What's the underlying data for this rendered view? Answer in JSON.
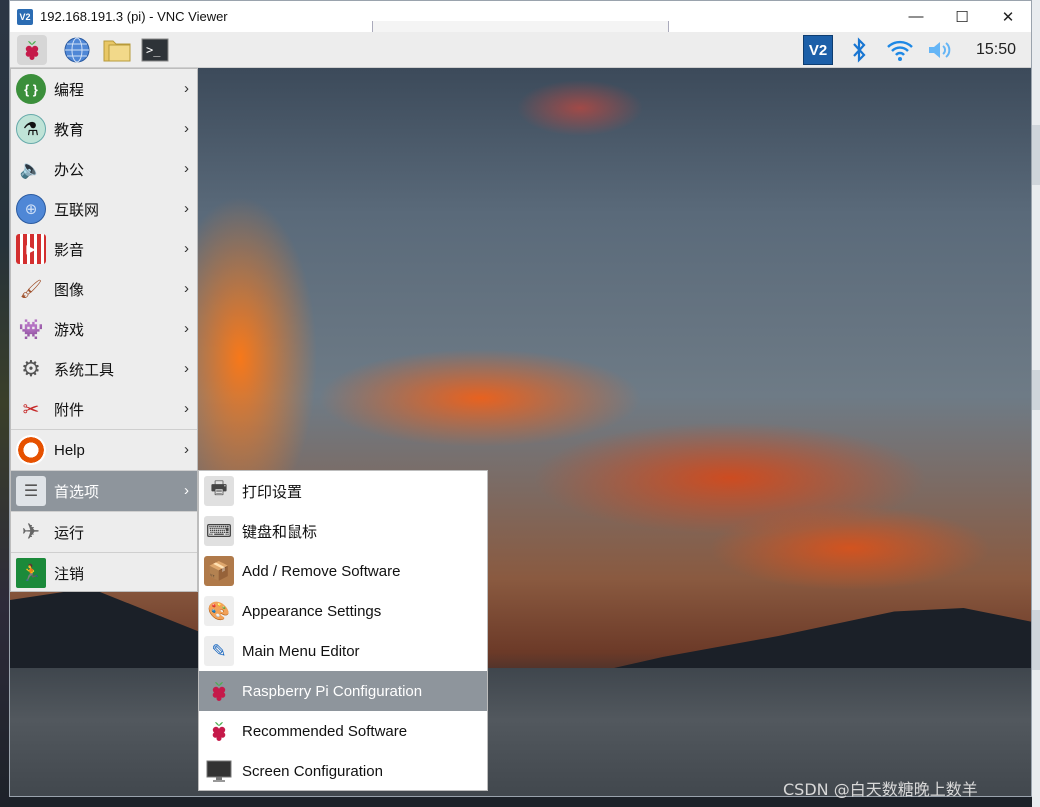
{
  "window": {
    "title": "192.168.191.3 (pi) - VNC Viewer",
    "app_icon": "V2",
    "minimize": "—",
    "maximize": "☐",
    "close": "✕"
  },
  "panel": {
    "clock": "15:50",
    "icons": [
      "raspberry-menu-icon",
      "web-browser-icon",
      "file-manager-icon",
      "terminal-icon",
      "vnc-icon",
      "bluetooth-icon",
      "wifi-icon",
      "volume-icon"
    ]
  },
  "menu": {
    "items": [
      {
        "label": "编程",
        "icon": "programming-icon"
      },
      {
        "label": "教育",
        "icon": "education-icon"
      },
      {
        "label": "办公",
        "icon": "office-icon"
      },
      {
        "label": "互联网",
        "icon": "internet-icon"
      },
      {
        "label": "影音",
        "icon": "sound-video-icon"
      },
      {
        "label": "图像",
        "icon": "graphics-icon"
      },
      {
        "label": "游戏",
        "icon": "games-icon"
      },
      {
        "label": "系统工具",
        "icon": "system-tools-icon"
      },
      {
        "label": "附件",
        "icon": "accessories-icon"
      },
      {
        "label": "Help",
        "icon": "help-icon"
      },
      {
        "label": "首选项",
        "icon": "preferences-icon"
      },
      {
        "label": "运行",
        "icon": "run-icon"
      },
      {
        "label": "注销",
        "icon": "logout-icon"
      }
    ]
  },
  "submenu": {
    "items": [
      {
        "label": "打印设置",
        "icon": "printer-icon"
      },
      {
        "label": "键盘和鼠标",
        "icon": "keyboard-mouse-icon"
      },
      {
        "label": "Add / Remove Software",
        "icon": "package-icon"
      },
      {
        "label": "Appearance Settings",
        "icon": "appearance-icon"
      },
      {
        "label": "Main Menu Editor",
        "icon": "menu-editor-icon"
      },
      {
        "label": "Raspberry Pi Configuration",
        "icon": "raspberry-icon"
      },
      {
        "label": "Recommended Software",
        "icon": "raspberry-icon"
      },
      {
        "label": "Screen Configuration",
        "icon": "monitor-icon"
      }
    ]
  },
  "watermark": "CSDN @白天数糖晚上数羊",
  "colors": {
    "selection": "#8e959c",
    "menu_bg": "#ededed",
    "panel_bg": "#ededed"
  }
}
